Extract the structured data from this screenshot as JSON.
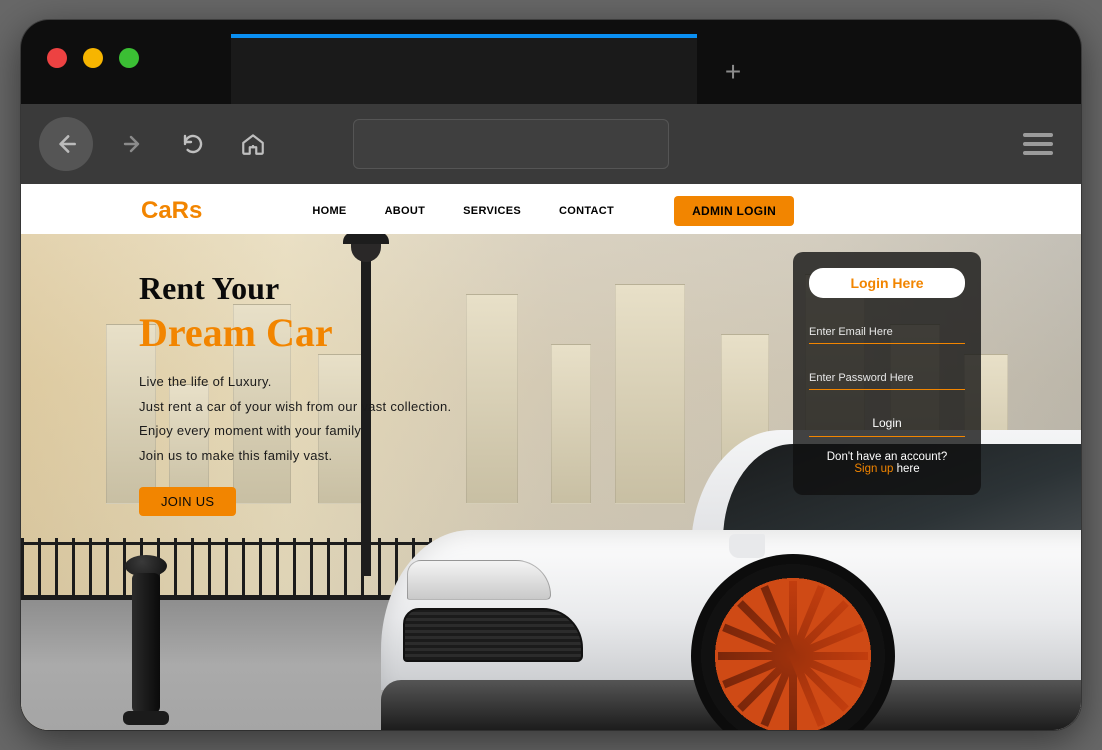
{
  "site": {
    "logo": "CaRs",
    "nav": {
      "home": "HOME",
      "about": "ABOUT",
      "services": "SERVICES",
      "contact": "CONTACT"
    },
    "admin_login": "ADMIN LOGIN"
  },
  "hero": {
    "title_line1": "Rent Your",
    "title_line2": "Dream Car",
    "para1": "Live the life of Luxury.",
    "para2": "Just rent a car of your wish from our vast collection.",
    "para3": "Enjoy every moment with your family",
    "para4": "Join us to make this family vast.",
    "join_button": "JOIN US"
  },
  "login": {
    "title": "Login Here",
    "email_placeholder": "Enter Email Here",
    "password_placeholder": "Enter Password Here",
    "login_button": "Login",
    "no_account_text": "Don't have an account?",
    "signup_link": "Sign up",
    "signup_suffix": " here"
  },
  "colors": {
    "accent": "#f28500"
  }
}
